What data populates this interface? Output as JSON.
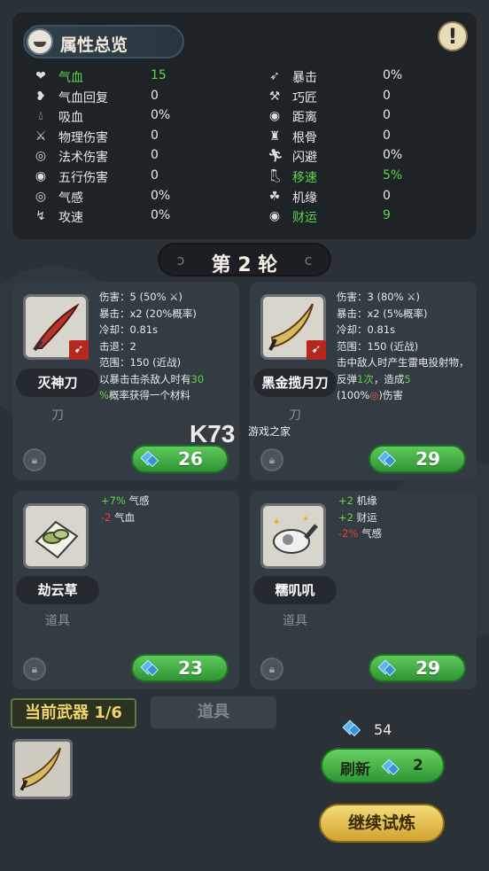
{
  "attributes": {
    "title": "属性总览",
    "left": [
      {
        "icon": "heart-icon",
        "name": "气血",
        "value": "15",
        "highlight": true
      },
      {
        "icon": "heart-regen-icon",
        "name": "气血回复",
        "value": "0",
        "highlight": false
      },
      {
        "icon": "blood-drop-icon",
        "name": "吸血",
        "value": "0%",
        "highlight": false
      },
      {
        "icon": "sword-icon",
        "name": "物理伤害",
        "value": "0",
        "highlight": false
      },
      {
        "icon": "spiral-icon",
        "name": "法术伤害",
        "value": "0",
        "highlight": false
      },
      {
        "icon": "five-elements-icon",
        "name": "五行伤害",
        "value": "0",
        "highlight": false
      },
      {
        "icon": "qi-icon",
        "name": "气感",
        "value": "0%",
        "highlight": false
      },
      {
        "icon": "attack-speed-icon",
        "name": "攻速",
        "value": "0%",
        "highlight": false
      }
    ],
    "right": [
      {
        "icon": "crit-icon",
        "name": "暴击",
        "value": "0%",
        "highlight": false
      },
      {
        "icon": "hammer-icon",
        "name": "巧匠",
        "value": "0",
        "highlight": false
      },
      {
        "icon": "target-icon",
        "name": "距离",
        "value": "0",
        "highlight": false
      },
      {
        "icon": "strength-icon",
        "name": "根骨",
        "value": "0",
        "highlight": false
      },
      {
        "icon": "dodge-icon",
        "name": "闪避",
        "value": "0%",
        "highlight": false
      },
      {
        "icon": "boot-icon",
        "name": "移速",
        "value": "5%",
        "highlight": true
      },
      {
        "icon": "luck-icon",
        "name": "机缘",
        "value": "0",
        "highlight": false
      },
      {
        "icon": "fortune-icon",
        "name": "财运",
        "value": "9",
        "highlight": true
      }
    ]
  },
  "round": {
    "label": "第 2 轮"
  },
  "cards": [
    {
      "name": "灭神刀",
      "category": "刀",
      "price": "26",
      "lines": [
        {
          "label": "伤害：",
          "value": "5 (50% ⚔)"
        },
        {
          "label": "暴击：",
          "value": "x2 (20%概率)"
        },
        {
          "label": "冷却：",
          "value": "0.81s"
        },
        {
          "label": "击退：",
          "value": "2"
        },
        {
          "label": "范围：",
          "value": "150 (近战)"
        }
      ],
      "effect_a": "以暴击击杀敌人时有",
      "effect_b": "30",
      "effect_c": "%",
      "effect_d": "概率获得一个材料"
    },
    {
      "name": "黑金揽月刀",
      "category": "刀",
      "price": "29",
      "lines": [
        {
          "label": "伤害：",
          "value": "3 (80% ⚔)"
        },
        {
          "label": "暴击：",
          "value": "x2 (5%概率)"
        },
        {
          "label": "冷却：",
          "value": "0.81s"
        },
        {
          "label": "范围：",
          "value": "150 (近战)"
        }
      ],
      "effect_a": "击中敌人时产生雷电投射物，反弹",
      "effect_b": "1次",
      "effect_c": "，造成",
      "effect_d": "5",
      "effect_e": "(100%",
      "effect_f": ")伤害"
    },
    {
      "name": "劫云草",
      "category": "道具",
      "price": "23",
      "mods": [
        {
          "delta": "+7%",
          "name": "气感",
          "color": "green"
        },
        {
          "delta": "-2",
          "name": "气血",
          "color": "red"
        }
      ]
    },
    {
      "name": "糯叽叽",
      "category": "道具",
      "price": "29",
      "mods": [
        {
          "delta": "+2",
          "name": "机缘",
          "color": "green"
        },
        {
          "delta": "+2",
          "name": "财运",
          "color": "green"
        },
        {
          "delta": "-2%",
          "name": "气感",
          "color": "red"
        }
      ]
    }
  ],
  "bottom": {
    "current_weapon": "当前武器 1/6",
    "tab_items": "道具",
    "gems": "54",
    "refresh_label": "刷新",
    "refresh_cost": "2",
    "continue_label": "继续试炼"
  },
  "watermark": {
    "big": "K73",
    "small": "游戏之家"
  },
  "colors": {
    "green": "#5ed64a",
    "red": "#e8423a",
    "gold": "#f0d36a"
  }
}
